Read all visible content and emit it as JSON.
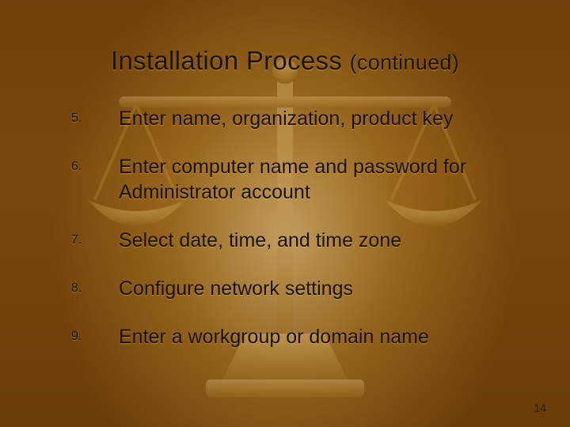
{
  "title_main": "Installation Process",
  "title_sub": "(continued)",
  "items": [
    {
      "num": "5.",
      "text": "Enter name, organization, product key"
    },
    {
      "num": "6.",
      "text": "Enter computer name and password for Administrator account"
    },
    {
      "num": "7.",
      "text": "Select date, time, and time zone"
    },
    {
      "num": "8.",
      "text": "Configure network settings"
    },
    {
      "num": "9.",
      "text": "Enter a workgroup or domain name"
    }
  ],
  "page_number": "14"
}
